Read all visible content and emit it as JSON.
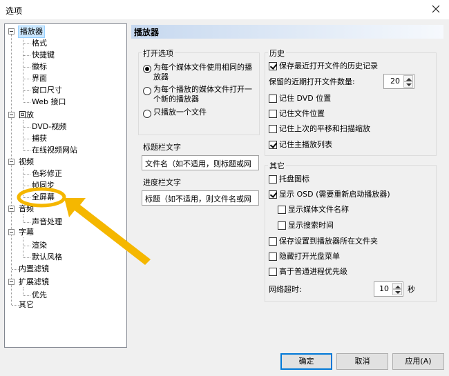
{
  "window": {
    "title": "选项"
  },
  "tree": {
    "root_player": "播放器",
    "player_children": [
      "格式",
      "快捷键",
      "徽标",
      "界面",
      "窗口尺寸",
      "Web 接口"
    ],
    "root_playback": "回放",
    "playback_children": [
      "DVD-视频",
      "捕获",
      "在线视频网站"
    ],
    "root_video": "视频",
    "video_children": [
      "色彩修正",
      "帧同步",
      "全屏幕"
    ],
    "root_audio": "音频",
    "audio_children": [
      "声音处理"
    ],
    "root_subtitle": "字幕",
    "subtitle_children": [
      "渲染",
      "默认风格"
    ],
    "root_builtin": "内置滤镜",
    "root_external": "扩展滤镜",
    "external_children": [
      "优先"
    ],
    "root_other": "其它"
  },
  "panel": {
    "header": "播放器",
    "open": {
      "title": "打开选项",
      "options": [
        {
          "label": "为每个媒体文件使用相同的播放器",
          "selected": true
        },
        {
          "label": "为每个播放的媒体文件打开一个新的播放器",
          "selected": false
        },
        {
          "label": "只播放一个文件",
          "selected": false
        }
      ]
    },
    "titlebar_text": {
      "label": "标题栏文字",
      "value": "文件名（如不适用，则标题或网"
    },
    "seekbar_text": {
      "label": "进度栏文字",
      "value": "标题（如不适用，则文件名或网"
    },
    "history": {
      "title": "历史",
      "keep_history": {
        "label": "保存最近打开文件的历史记录",
        "checked": true
      },
      "recent_count_label": "保留的近期打开文件数量:",
      "recent_count": "20",
      "items": [
        {
          "label": "记住 DVD 位置",
          "checked": false
        },
        {
          "label": "记住文件位置",
          "checked": false
        },
        {
          "label": "记住上次的平移和扫描缩放",
          "checked": false
        },
        {
          "label": "记住主播放列表",
          "checked": true
        }
      ]
    },
    "other": {
      "title": "其它",
      "tray_icon": {
        "label": "托盘图标",
        "checked": false
      },
      "show_osd": {
        "label": "显示 OSD (需要重新启动播放器)",
        "checked": true
      },
      "show_filename": {
        "label": "显示媒体文件名称",
        "checked": false
      },
      "show_seektime": {
        "label": "显示搜索时间",
        "checked": false
      },
      "save_to_folder": {
        "label": "保存设置到播放器所在文件夹",
        "checked": false
      },
      "hide_cdrom": {
        "label": "隐藏打开光盘菜单",
        "checked": false
      },
      "above_normal": {
        "label": "高于普通进程优先级",
        "checked": false
      },
      "timeout_label": "网络超时:",
      "timeout_value": "10",
      "timeout_unit": "秒"
    }
  },
  "buttons": {
    "ok": "确定",
    "cancel": "取消",
    "apply": "应用(A)"
  },
  "colors": {
    "selection": "#cce8ff",
    "annotation": "#f5b700",
    "focus": "#0078d7"
  }
}
